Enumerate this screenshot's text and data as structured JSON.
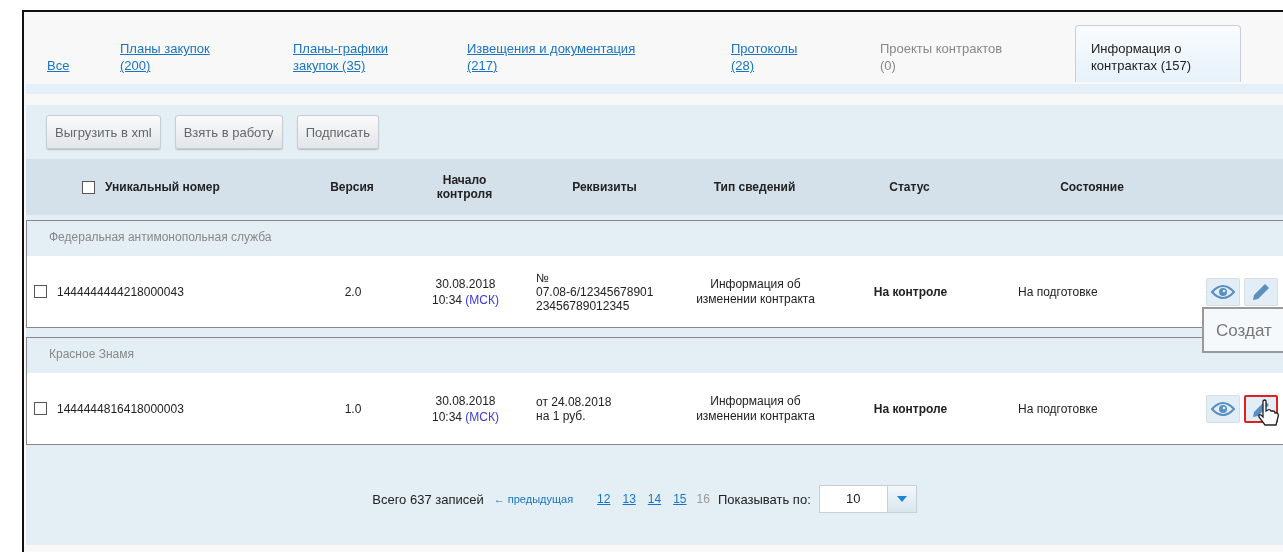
{
  "tabs": [
    {
      "label": "Все",
      "selected": false,
      "disabled": false
    },
    {
      "label": "Планы закупок (200)",
      "selected": false,
      "disabled": false
    },
    {
      "label": "Планы-графики закупок (35)",
      "selected": false,
      "disabled": false
    },
    {
      "label": "Извещения и документация (217)",
      "selected": false,
      "disabled": false
    },
    {
      "label": "Протоколы (28)",
      "selected": false,
      "disabled": false
    },
    {
      "label": "Проекты контрактов (0)",
      "selected": false,
      "disabled": true
    },
    {
      "label": "Информация о контрактах (157)",
      "selected": true,
      "disabled": false
    }
  ],
  "toolbar": [
    "Выгрузить в xml",
    "Взять в работу",
    "Подписать"
  ],
  "table": {
    "select_all": {
      "checked": false
    },
    "columns": [
      "Уникальный номер",
      "Версия",
      "Начало контроля",
      "Реквизиты",
      "Тип сведений",
      "Статус",
      "Состояние"
    ],
    "groups": [
      {
        "title": "Федеральная антимонопольная служба",
        "rows": [
          {
            "checked": false,
            "number": "1444444444218000043",
            "version": "2.0",
            "date": "30.08.2018",
            "time": "10:34",
            "timezone": "(МСК)",
            "requisites": "№\n07.08-6/12345678901\n23456789012345",
            "type": "Информация об изменении контракта",
            "status": "На контроле",
            "state": "На подготовке",
            "edit_highlighted": false
          }
        ]
      },
      {
        "title": "Красное Знамя",
        "rows": [
          {
            "checked": false,
            "number": "1444444816418000003",
            "version": "1.0",
            "date": "30.08.2018",
            "time": "10:34",
            "timezone": "(МСК)",
            "requisites": "от 24.08.2018\nна 1 руб.",
            "type": "Информация об изменении контракта",
            "status": "На контроле",
            "state": "На подготовке",
            "edit_highlighted": true
          }
        ]
      }
    ],
    "tooltip": "Создат"
  },
  "pager": {
    "total": "Всего 637 записей",
    "previous": "← предыдущая",
    "pages": [
      {
        "label": "12",
        "selected": false
      },
      {
        "label": "13",
        "selected": false
      },
      {
        "label": "14",
        "selected": false
      },
      {
        "label": "15",
        "selected": false
      },
      {
        "label": "16",
        "selected": true
      }
    ],
    "per_page_label": "Показывать по:",
    "per_page": "10"
  }
}
